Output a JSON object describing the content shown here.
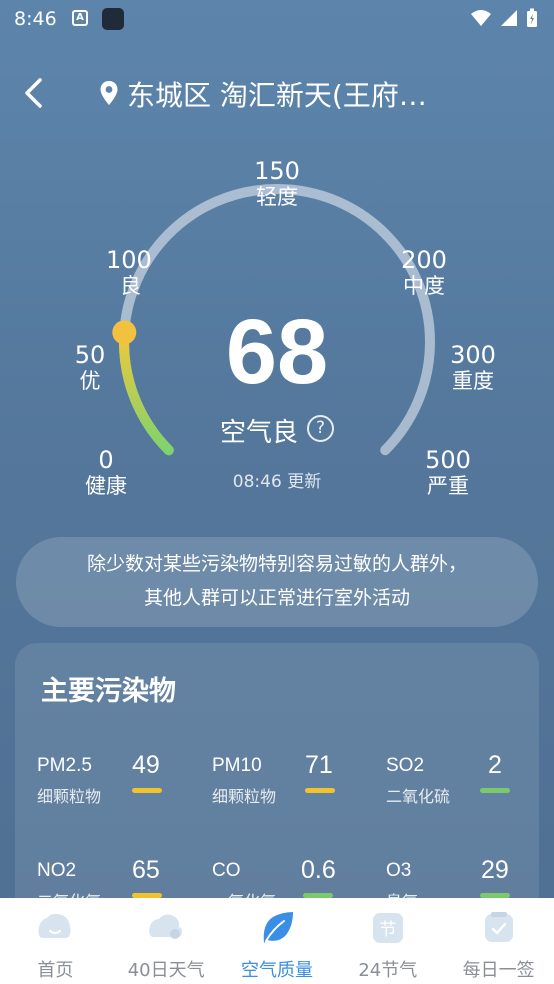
{
  "status_bar": {
    "time": "8:46",
    "icon_a": "A"
  },
  "header": {
    "location": "东城区 淘汇新天(王府…"
  },
  "gauge": {
    "aqi": "68",
    "level": "空气良",
    "help": "?",
    "update_time": "08:46 更新",
    "marker_fraction": 0.18,
    "scale": [
      {
        "num": "0",
        "text": "健康"
      },
      {
        "num": "50",
        "text": "优"
      },
      {
        "num": "100",
        "text": "良"
      },
      {
        "num": "150",
        "text": "轻度"
      },
      {
        "num": "200",
        "text": "中度"
      },
      {
        "num": "300",
        "text": "重度"
      },
      {
        "num": "500",
        "text": "严重"
      }
    ]
  },
  "advice": {
    "line1": "除少数对某些污染物特别容易过敏的人群外，",
    "line2": "其他人群可以正常进行室外活动"
  },
  "pollutants": {
    "title": "主要污染物",
    "items": [
      {
        "name": "PM2.5",
        "desc": "细颗粒物",
        "value": "49",
        "color": "#f2c12e"
      },
      {
        "name": "PM10",
        "desc": "细颗粒物",
        "value": "71",
        "color": "#f2c12e"
      },
      {
        "name": "SO2",
        "desc": "二氧化硫",
        "value": "2",
        "color": "#7cc96c"
      },
      {
        "name": "NO2",
        "desc": "二氧化氮",
        "value": "65",
        "color": "#f2c12e"
      },
      {
        "name": "CO",
        "desc": "一氧化氮",
        "value": "0.6",
        "color": "#7cc96c"
      },
      {
        "name": "O3",
        "desc": "臭氧",
        "value": "29",
        "color": "#7cc96c"
      }
    ]
  },
  "tabs": [
    {
      "label": "首页",
      "icon": "home-cloud-icon"
    },
    {
      "label": "40日天气",
      "icon": "forecast-cloud-icon"
    },
    {
      "label": "空气质量",
      "icon": "leaf-icon",
      "active": true
    },
    {
      "label": "24节气",
      "icon": "solar-term-icon",
      "badge": "节"
    },
    {
      "label": "每日一签",
      "icon": "daily-sign-icon"
    }
  ],
  "colors": {
    "accent": "#3a8ee6",
    "good": "#7cc96c",
    "moderate": "#f2c12e"
  }
}
